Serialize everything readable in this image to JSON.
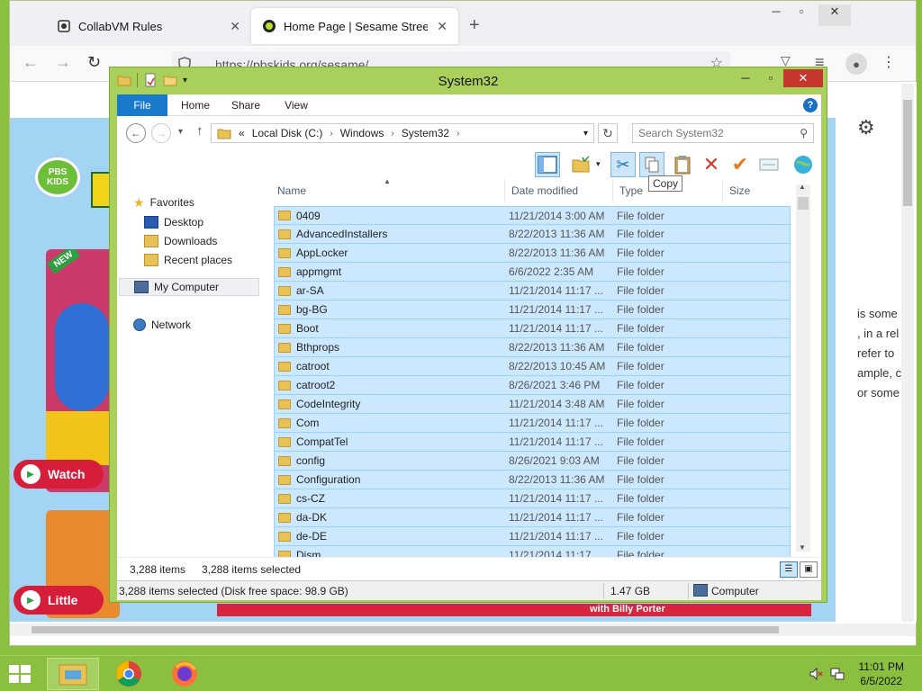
{
  "browser": {
    "tabs": [
      {
        "label": "CollabVM Rules"
      },
      {
        "label": "Home Page | Sesame Street | PBS"
      }
    ],
    "url": "https://pbskids.org/sesame/",
    "page": {
      "logo_text": "PBS KIDS",
      "new_badge": "NEW",
      "card1_button": "Watch",
      "card2_button": "Little",
      "side_text": [
        "is some",
        ", in a rel",
        "refer to",
        "ample, c",
        "or some"
      ],
      "bottom_text": "with Billy Porter"
    }
  },
  "explorer": {
    "title": "System32",
    "ribbon_tabs": [
      "File",
      "Home",
      "Share",
      "View"
    ],
    "breadcrumb": [
      "«",
      "Local Disk (C:)",
      "Windows",
      "System32"
    ],
    "search_placeholder": "Search System32",
    "tooltip": "Copy",
    "nav": {
      "favorites": "Favorites",
      "desktop": "Desktop",
      "downloads": "Downloads",
      "recent": "Recent places",
      "my_computer": "My Computer",
      "network": "Network"
    },
    "columns": [
      "Name",
      "Date modified",
      "Type",
      "Size"
    ],
    "rows": [
      {
        "name": "0409",
        "date": "11/21/2014 3:00 AM",
        "type": "File folder"
      },
      {
        "name": "AdvancedInstallers",
        "date": "8/22/2013 11:36 AM",
        "type": "File folder"
      },
      {
        "name": "AppLocker",
        "date": "8/22/2013 11:36 AM",
        "type": "File folder"
      },
      {
        "name": "appmgmt",
        "date": "6/6/2022 2:35 AM",
        "type": "File folder"
      },
      {
        "name": "ar-SA",
        "date": "11/21/2014 11:17 ...",
        "type": "File folder"
      },
      {
        "name": "bg-BG",
        "date": "11/21/2014 11:17 ...",
        "type": "File folder"
      },
      {
        "name": "Boot",
        "date": "11/21/2014 11:17 ...",
        "type": "File folder"
      },
      {
        "name": "Bthprops",
        "date": "8/22/2013 11:36 AM",
        "type": "File folder"
      },
      {
        "name": "catroot",
        "date": "8/22/2013 10:45 AM",
        "type": "File folder"
      },
      {
        "name": "catroot2",
        "date": "8/26/2021 3:46 PM",
        "type": "File folder"
      },
      {
        "name": "CodeIntegrity",
        "date": "11/21/2014 3:48 AM",
        "type": "File folder"
      },
      {
        "name": "Com",
        "date": "11/21/2014 11:17 ...",
        "type": "File folder"
      },
      {
        "name": "CompatTel",
        "date": "11/21/2014 11:17 ...",
        "type": "File folder"
      },
      {
        "name": "config",
        "date": "8/26/2021 9:03 AM",
        "type": "File folder"
      },
      {
        "name": "Configuration",
        "date": "8/22/2013 11:36 AM",
        "type": "File folder"
      },
      {
        "name": "cs-CZ",
        "date": "11/21/2014 11:17 ...",
        "type": "File folder"
      },
      {
        "name": "da-DK",
        "date": "11/21/2014 11:17 ...",
        "type": "File folder"
      },
      {
        "name": "de-DE",
        "date": "11/21/2014 11:17 ...",
        "type": "File folder"
      },
      {
        "name": "Dism",
        "date": "11/21/2014 11:17 ...",
        "type": "File folder"
      }
    ],
    "status": {
      "items": "3,288 items",
      "selected": "3,288 items selected",
      "bar_selected": "3,288 items selected (Disk free space: 98.9 GB)",
      "size": "1.47 GB",
      "location": "Computer"
    }
  },
  "taskbar": {
    "time": "11:01 PM",
    "date": "6/5/2022"
  }
}
